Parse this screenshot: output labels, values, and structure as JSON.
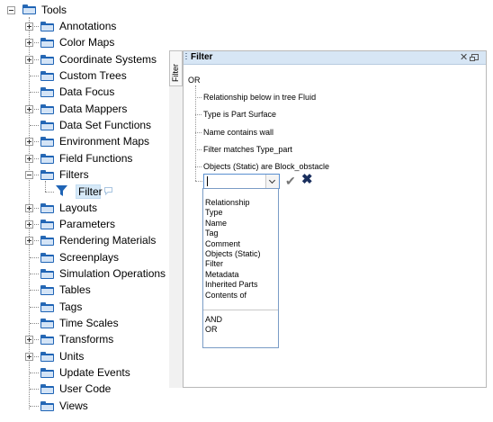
{
  "tree": {
    "root_label": "Tools",
    "items": [
      {
        "label": "Annotations",
        "expander": "plus"
      },
      {
        "label": "Color Maps",
        "expander": "plus"
      },
      {
        "label": "Coordinate Systems",
        "expander": "plus"
      },
      {
        "label": "Custom Trees",
        "expander": "none"
      },
      {
        "label": "Data Focus",
        "expander": "none"
      },
      {
        "label": "Data Mappers",
        "expander": "plus"
      },
      {
        "label": "Data Set Functions",
        "expander": "none"
      },
      {
        "label": "Environment Maps",
        "expander": "plus"
      },
      {
        "label": "Field Functions",
        "expander": "plus"
      },
      {
        "label": "Filters",
        "expander": "minus"
      },
      {
        "label": "Layouts",
        "expander": "plus"
      },
      {
        "label": "Parameters",
        "expander": "plus"
      },
      {
        "label": "Rendering Materials",
        "expander": "plus"
      },
      {
        "label": "Screenplays",
        "expander": "none"
      },
      {
        "label": "Simulation Operations",
        "expander": "none"
      },
      {
        "label": "Tables",
        "expander": "none"
      },
      {
        "label": "Tags",
        "expander": "none"
      },
      {
        "label": "Time Scales",
        "expander": "none"
      },
      {
        "label": "Transforms",
        "expander": "plus"
      },
      {
        "label": "Units",
        "expander": "plus"
      },
      {
        "label": "Update Events",
        "expander": "none"
      },
      {
        "label": "User Code",
        "expander": "none"
      },
      {
        "label": "Views",
        "expander": "none"
      }
    ],
    "filters_child": {
      "label": "Filter"
    }
  },
  "side_tab": {
    "label": "Filter"
  },
  "panel": {
    "title": "Filter",
    "close_icon": "✕",
    "root_operator": "OR",
    "conditions": [
      "Relationship below in tree Fluid",
      "Type is Part Surface",
      "Name contains wall",
      "Filter matches Type_part",
      "Objects (Static) are Block_obstacle"
    ],
    "combo_value": "",
    "dropdown_options": [
      "Relationship",
      "Type",
      "Name",
      "Tag",
      "Comment",
      "Objects (Static)",
      "Filter",
      "Metadata",
      "Inherited Parts",
      "Contents of"
    ],
    "dropdown_operators": [
      "AND",
      "OR"
    ]
  },
  "colors": {
    "folder": "#1f64b5",
    "selection": "#d6e9f8",
    "panel_header": "#d7e6f5",
    "accept": "#777777",
    "cancel": "#1a2f5e"
  }
}
